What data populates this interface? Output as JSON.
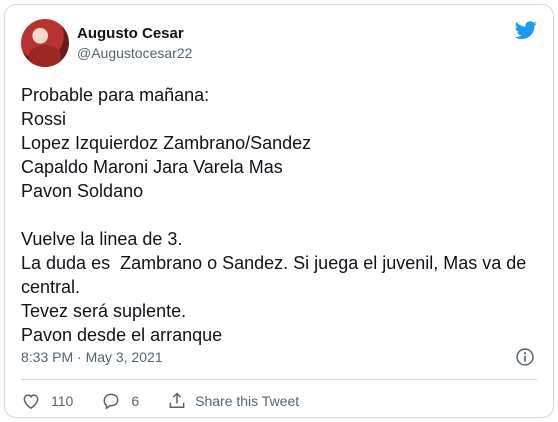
{
  "author": {
    "name": "Augusto Cesar",
    "handle": "@Augustocesar22"
  },
  "tweet": {
    "text": "Probable para mañana:\nRossi\nLopez Izquierdoz Zambrano/Sandez\nCapaldo Maroni Jara Varela Mas\nPavon Soldano\n\nVuelve la linea de 3.\nLa duda es  Zambrano o Sandez. Si juega el juvenil, Mas va de central.\nTevez será suplente.\nPavon desde el arranque",
    "timestamp": "8:33 PM · May 3, 2021"
  },
  "actions": {
    "likes": "110",
    "replies": "6",
    "share_label": "Share this Tweet"
  },
  "icons": {
    "logo": "twitter-bird-icon",
    "info": "info-icon",
    "like": "heart-icon",
    "reply": "reply-icon",
    "share": "share-icon"
  },
  "colors": {
    "brand": "#1d9bf0",
    "muted": "#536471",
    "text": "#0f1419",
    "border": "#cfd9de"
  }
}
